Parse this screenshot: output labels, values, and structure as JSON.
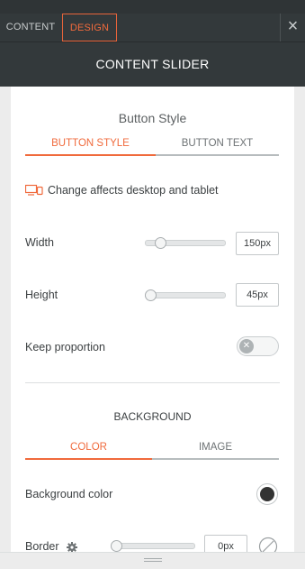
{
  "tabs": {
    "content": "CONTENT",
    "design": "DESIGN"
  },
  "header": {
    "title": "CONTENT SLIDER"
  },
  "button_style": {
    "title": "Button Style",
    "tabs": [
      "BUTTON STYLE",
      "BUTTON TEXT"
    ],
    "device_note": "Change affects desktop and tablet",
    "width": {
      "label": "Width",
      "value": "150px",
      "slider_level": 0.1
    },
    "height": {
      "label": "Height",
      "value": "45px",
      "slider_level": 0.0
    },
    "keep_proportion": {
      "label": "Keep proportion",
      "enabled": false
    }
  },
  "background": {
    "title": "BACKGROUND",
    "tabs": [
      "COLOR",
      "IMAGE"
    ],
    "color_label": "Background color",
    "color_value": "#333333",
    "border": {
      "label": "Border",
      "value": "0px",
      "slider_level": 0.0
    }
  },
  "colors": {
    "accent": "#f06a3c",
    "dark_bar": "#33393b",
    "panel": "#ffffff"
  }
}
